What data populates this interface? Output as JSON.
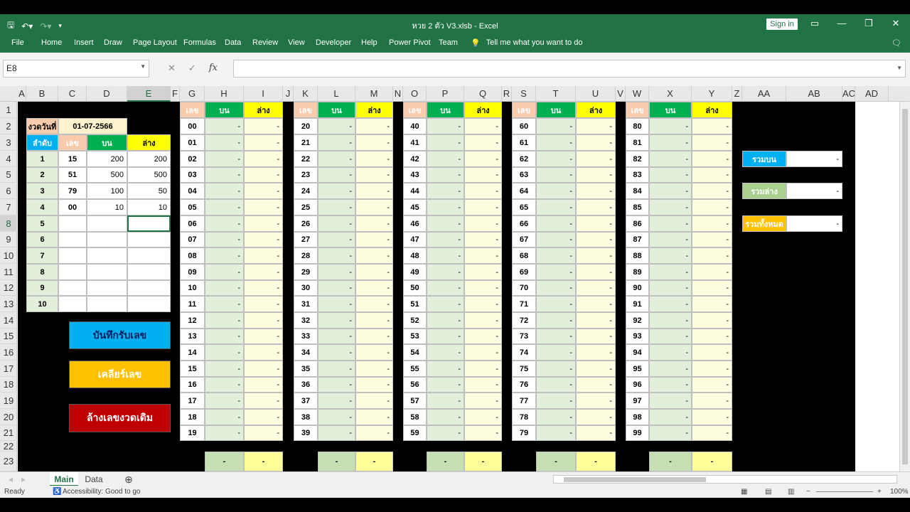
{
  "window": {
    "title": "หวย 2 ตัว V3.xlsb  -  Excel",
    "sign_in": "Sign in",
    "ribbon_display_icon": "ribbon-display-icon",
    "minimize_icon": "minimize-icon",
    "restore_icon": "restore-icon",
    "close_icon": "close-icon"
  },
  "ribbon": {
    "tabs": [
      "File",
      "Home",
      "Insert",
      "Draw",
      "Page Layout",
      "Formulas",
      "Data",
      "Review",
      "View",
      "Developer",
      "Help",
      "Power Pivot",
      "Team"
    ],
    "tell_me": "Tell me what you want to do"
  },
  "formula_bar": {
    "name_box": "E8",
    "formula": ""
  },
  "columns": [
    "A",
    "B",
    "C",
    "D",
    "E",
    "F",
    "G",
    "H",
    "I",
    "J",
    "K",
    "L",
    "M",
    "N",
    "O",
    "P",
    "Q",
    "R",
    "S",
    "T",
    "U",
    "V",
    "W",
    "X",
    "Y",
    "Z",
    "AA",
    "AB",
    "AC",
    "AD"
  ],
  "rows": [
    "1",
    "2",
    "3",
    "4",
    "5",
    "6",
    "7",
    "8",
    "9",
    "10",
    "11",
    "12",
    "13",
    "14",
    "15",
    "16",
    "17",
    "18",
    "19",
    "20",
    "21",
    "22",
    "23"
  ],
  "input_panel": {
    "date_label": "งวดวันที่",
    "date_value": "01-07-2566",
    "headers": [
      "ลำดับ",
      "เลข",
      "บน",
      "ล่าง"
    ],
    "rows": [
      {
        "no": "1",
        "num": "15",
        "top": "200",
        "bottom": "200"
      },
      {
        "no": "2",
        "num": "51",
        "top": "500",
        "bottom": "500"
      },
      {
        "no": "3",
        "num": "79",
        "top": "100",
        "bottom": "50"
      },
      {
        "no": "4",
        "num": "00",
        "top": "10",
        "bottom": "10"
      },
      {
        "no": "5",
        "num": "",
        "top": "",
        "bottom": ""
      },
      {
        "no": "6",
        "num": "",
        "top": "",
        "bottom": ""
      },
      {
        "no": "7",
        "num": "",
        "top": "",
        "bottom": ""
      },
      {
        "no": "8",
        "num": "",
        "top": "",
        "bottom": ""
      },
      {
        "no": "9",
        "num": "",
        "top": "",
        "bottom": ""
      },
      {
        "no": "10",
        "num": "",
        "top": "",
        "bottom": ""
      }
    ]
  },
  "buttons": {
    "save": "บันทึกรับเลข",
    "clear": "เคลียร์เลข",
    "reset": "ล้างเลขงวดเดิม"
  },
  "blocks": {
    "headers": [
      "เลข",
      "บน",
      "ล่าง"
    ],
    "dash": "-",
    "numbers": [
      [
        "00",
        "01",
        "02",
        "03",
        "04",
        "05",
        "06",
        "07",
        "08",
        "09",
        "10",
        "11",
        "12",
        "13",
        "14",
        "15",
        "16",
        "17",
        "18",
        "19"
      ],
      [
        "20",
        "21",
        "22",
        "23",
        "24",
        "25",
        "26",
        "27",
        "28",
        "29",
        "30",
        "31",
        "32",
        "33",
        "34",
        "35",
        "36",
        "37",
        "38",
        "39"
      ],
      [
        "40",
        "41",
        "42",
        "43",
        "44",
        "45",
        "46",
        "47",
        "48",
        "49",
        "50",
        "51",
        "52",
        "53",
        "54",
        "55",
        "56",
        "57",
        "58",
        "59"
      ],
      [
        "60",
        "61",
        "62",
        "63",
        "64",
        "65",
        "66",
        "67",
        "68",
        "69",
        "70",
        "71",
        "72",
        "73",
        "74",
        "75",
        "76",
        "77",
        "78",
        "79"
      ],
      [
        "80",
        "81",
        "82",
        "83",
        "84",
        "85",
        "86",
        "87",
        "88",
        "89",
        "90",
        "91",
        "92",
        "93",
        "94",
        "95",
        "96",
        "97",
        "98",
        "99"
      ]
    ]
  },
  "summary": [
    {
      "label": "รวมบน",
      "value": "-"
    },
    {
      "label": "รวมล่าง",
      "value": "-"
    },
    {
      "label": "รวมทั้งหมด",
      "value": "-"
    }
  ],
  "sheets": [
    "Main",
    "Data"
  ],
  "status": {
    "ready": "Ready",
    "accessibility": "Accessibility: Good to go",
    "zoom": "100%"
  },
  "colors": {
    "excel_green": "#217346",
    "header_peach": "#f8cbad",
    "header_green": "#00b050",
    "header_yellow": "#ffff00",
    "header_blue": "#00b0f0",
    "light_green": "#e2efda",
    "light_yellow": "#fffde0",
    "btn_blue": "#00b0f0",
    "btn_orange": "#ffc000",
    "btn_red": "#c00000"
  }
}
